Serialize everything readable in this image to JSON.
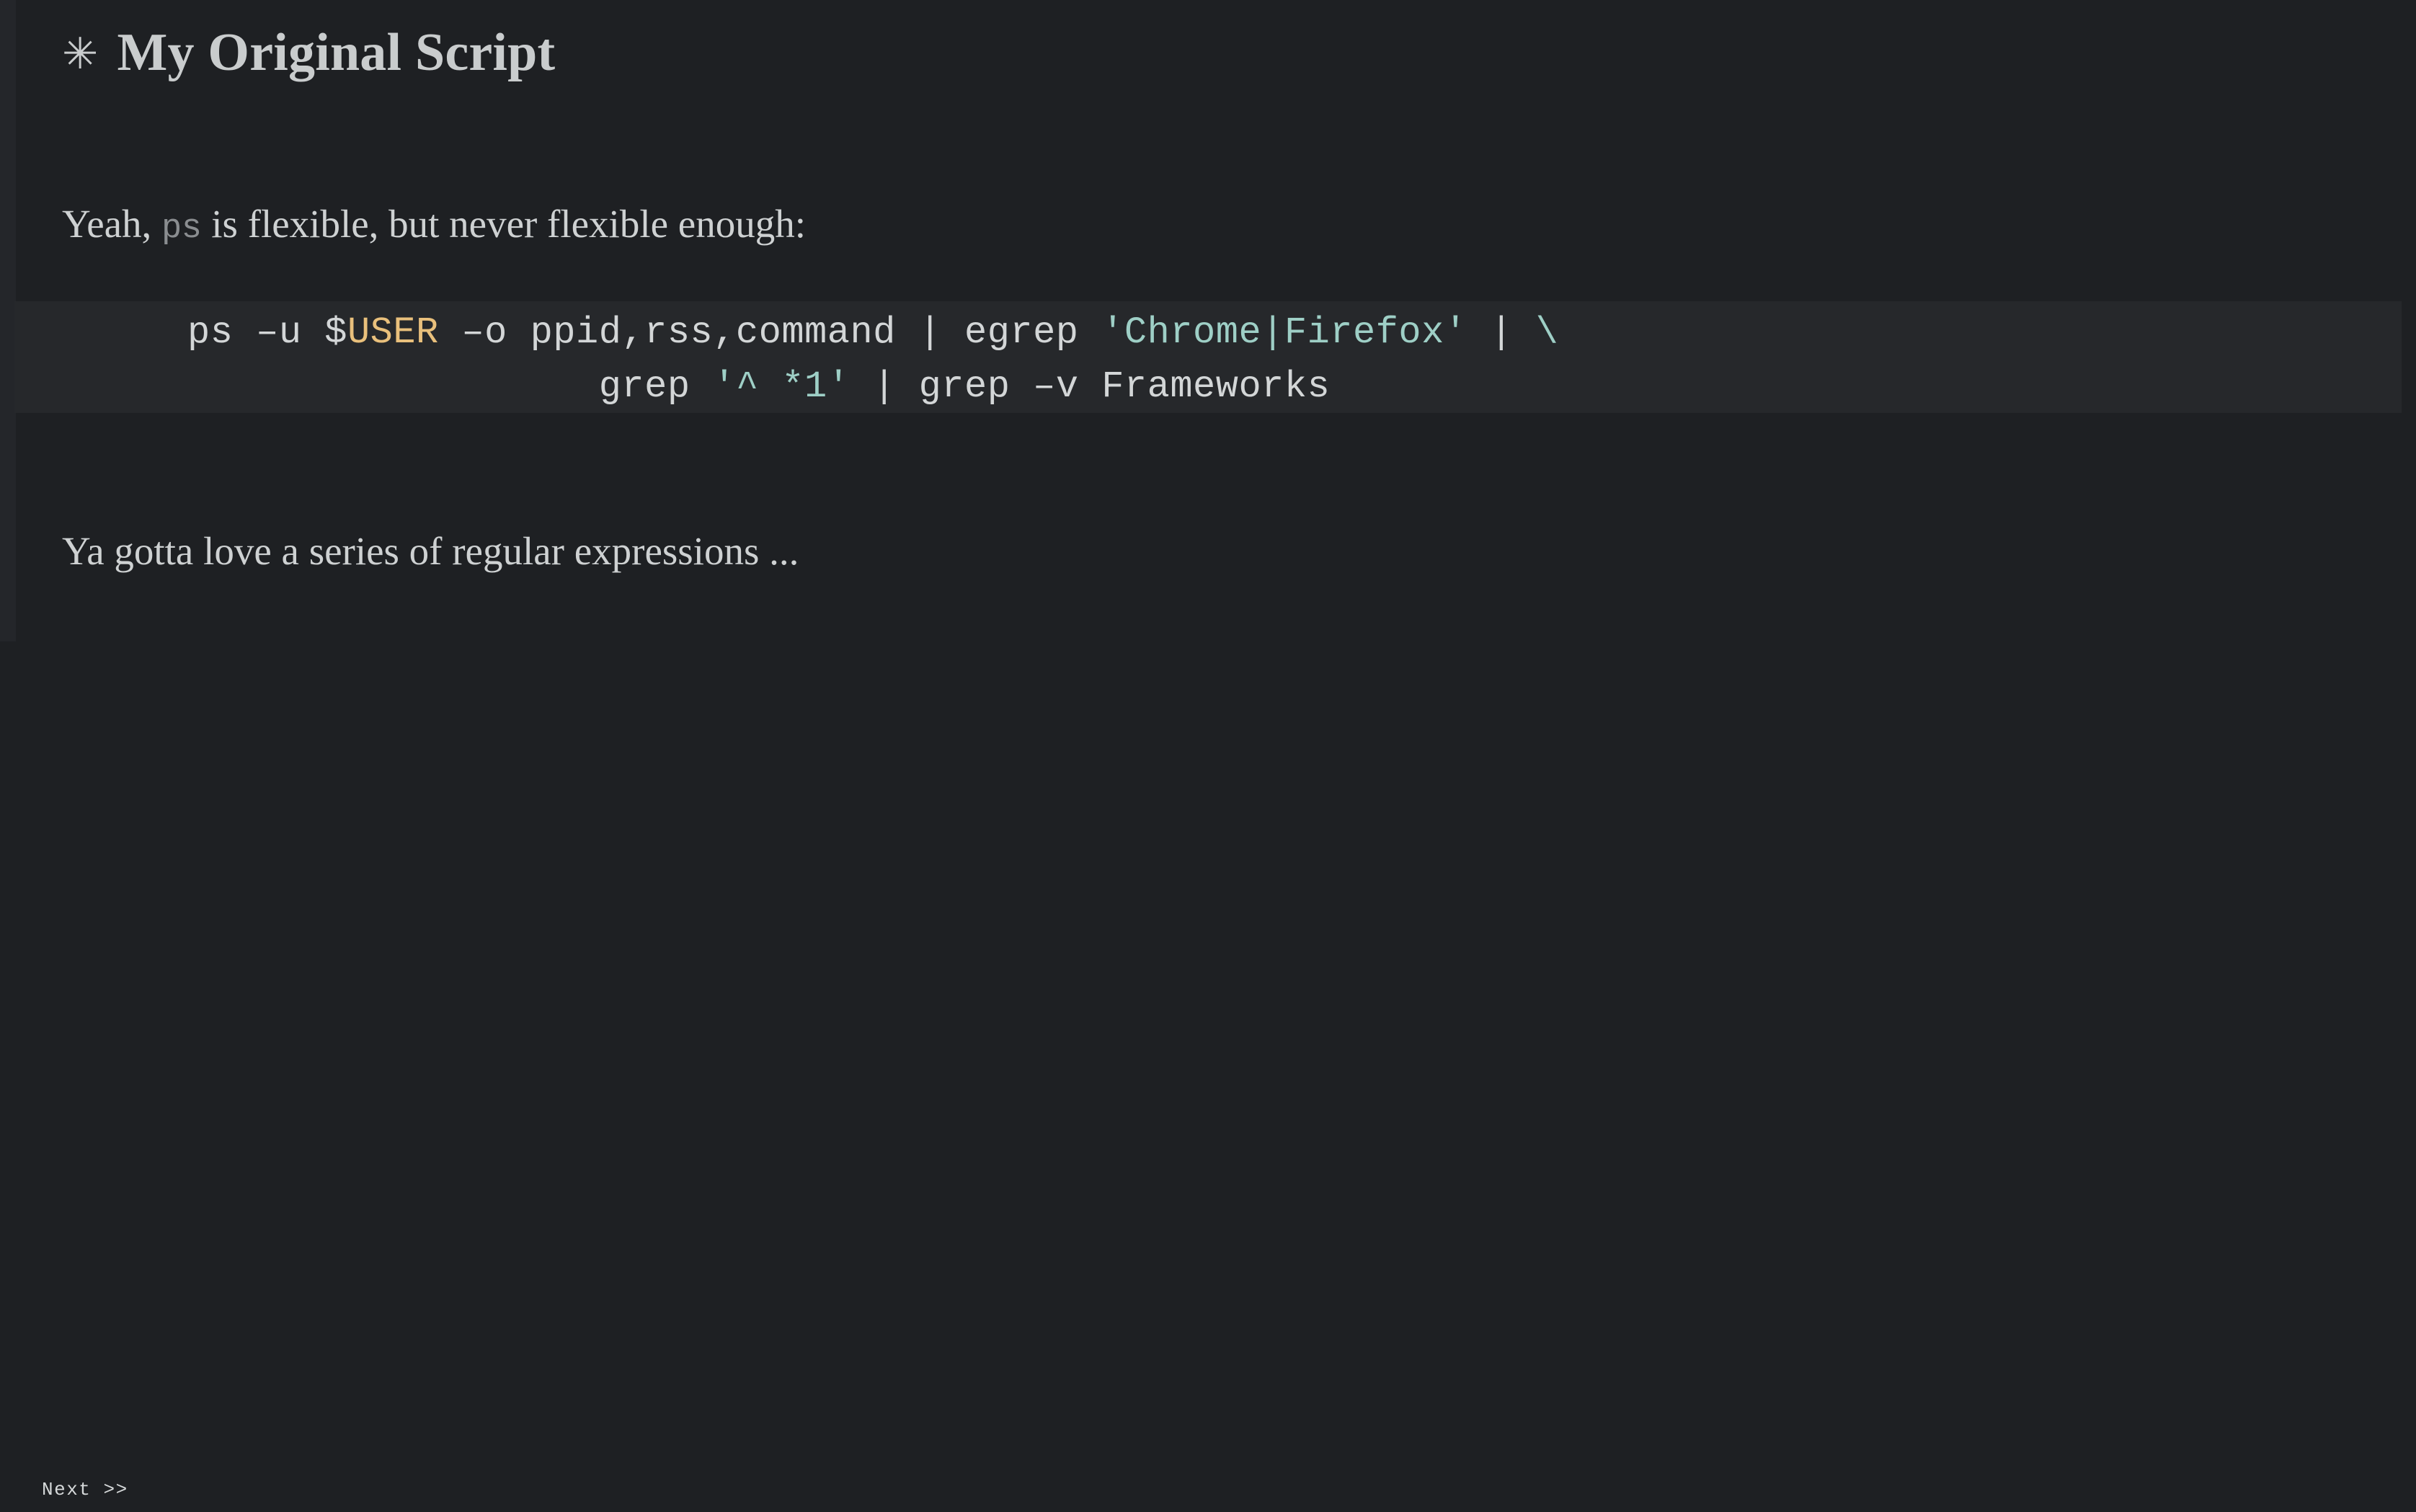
{
  "page": {
    "background_color": "#1e2023",
    "text_color": "#ced1d2"
  },
  "title": {
    "bullet_icon": "✳",
    "text": "My Original Script"
  },
  "body": {
    "intro_before": "Yeah, ",
    "intro_code": "ps",
    "intro_after": " is flexible, but never flexible enough:",
    "outro": "Ya gotta love a series of regular expressions ..."
  },
  "code_block": {
    "background_color": "#26282b",
    "default_color": "#d3d6d7",
    "string_color": "#9ecfc6",
    "variable_color": "#e9c07c",
    "lines": [
      {
        "indent": "",
        "tokens": [
          {
            "text": "ps –u $",
            "type": "plain"
          },
          {
            "text": "USER",
            "type": "variable"
          },
          {
            "text": " –o ppid,rss,command | egrep ",
            "type": "plain"
          },
          {
            "text": "'Chrome|Firefox'",
            "type": "string"
          },
          {
            "text": " | ",
            "type": "plain"
          },
          {
            "text": "\\",
            "type": "string"
          }
        ]
      },
      {
        "indent": "                  ",
        "tokens": [
          {
            "text": "grep ",
            "type": "plain"
          },
          {
            "text": "'^ *1'",
            "type": "string"
          },
          {
            "text": " | grep –v Frameworks",
            "type": "plain"
          }
        ]
      }
    ],
    "plain_text": "ps –u $USER –o ppid,rss,command | egrep 'Chrome|Firefox' | \\\n                  grep '^ *1' | grep –v Frameworks"
  },
  "footer": {
    "next_label": "Next >>"
  }
}
